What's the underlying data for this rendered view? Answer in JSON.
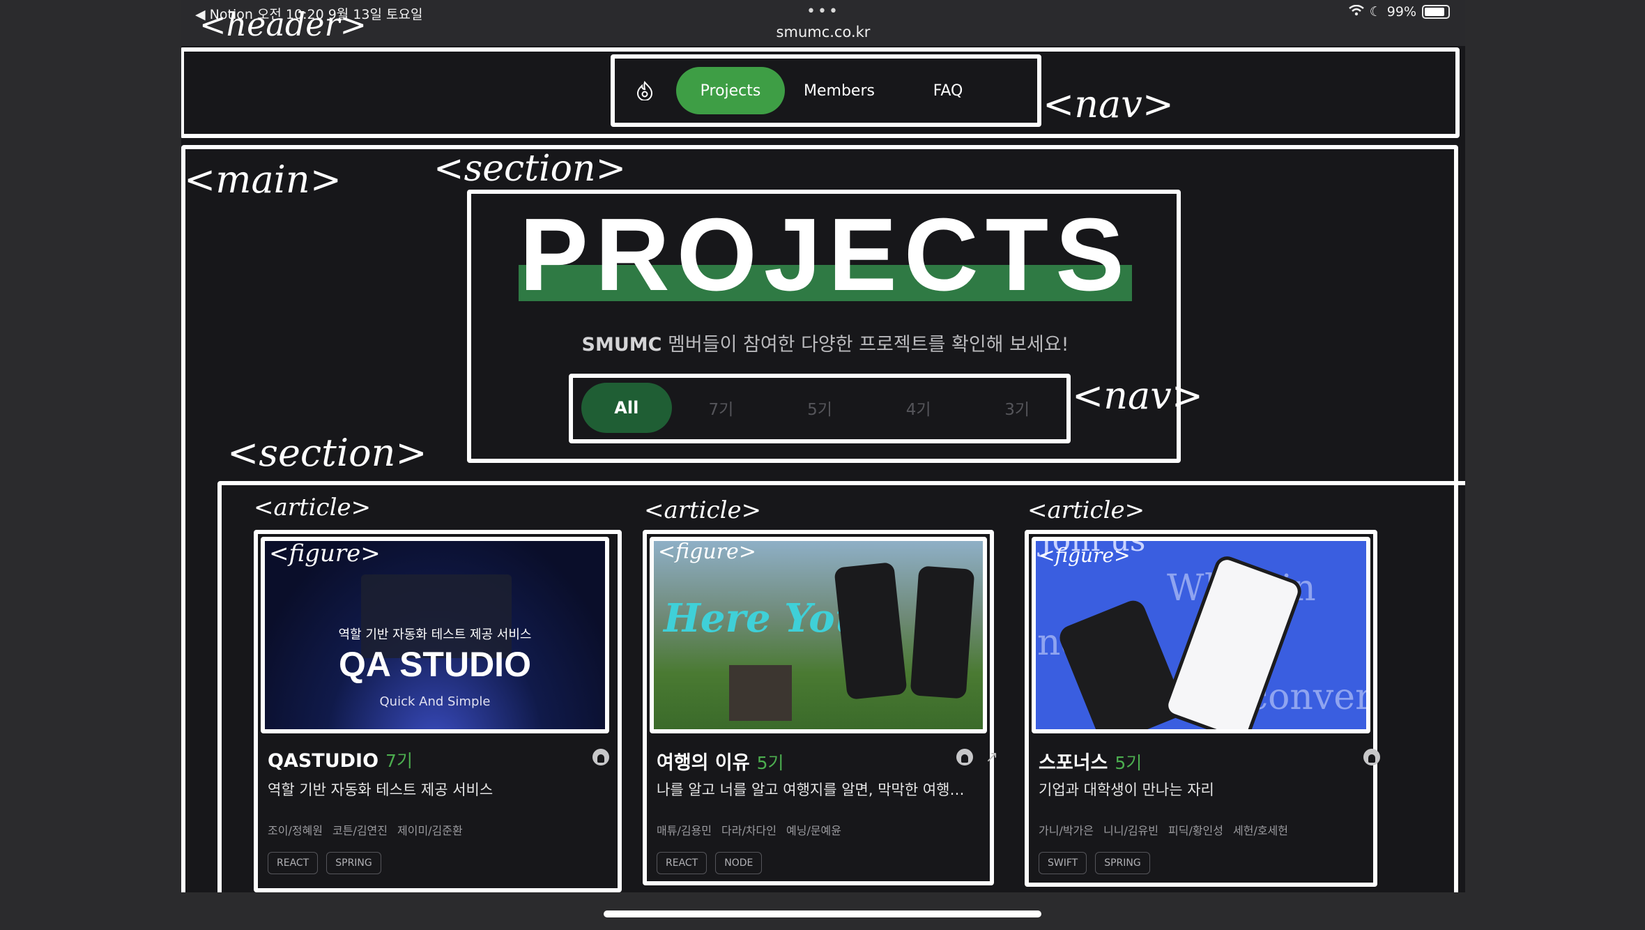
{
  "status_bar": {
    "left": "◀ Notion  오전 10:20  9월 13일 토요일",
    "battery": "99%",
    "dots": "•••",
    "url": "smumc.co.kr"
  },
  "nav": {
    "items": [
      "Projects",
      "Members",
      "FAQ"
    ],
    "active": "Projects"
  },
  "hero": {
    "title": "PROJECTS",
    "subtitle_strong": "SMUMC",
    "subtitle_rest": " 멤버들이 참여한 다양한 프로젝트를 확인해 보세요!",
    "filters": [
      "All",
      "7기",
      "5기",
      "4기",
      "3기"
    ]
  },
  "cards": [
    {
      "title": "QASTUDIO",
      "gen": "7기",
      "desc": "역할 기반 자동화 테스트 제공 서비스",
      "members": [
        "조이/정혜원",
        "코튼/김연진",
        "제이미/김준환"
      ],
      "tags": [
        "REACT",
        "SPRING"
      ],
      "image": {
        "subtitle": "역할 기반 자동화 테스트 제공 서비스",
        "logo": "QA STUDIO",
        "tagline": "Quick And Simple"
      }
    },
    {
      "title": "여행의 이유",
      "gen": "5기",
      "desc": "나를 알고 너를 알고 여행지를 알면, 막막한 여행도 ...",
      "members": [
        "매튜/김용민",
        "다라/차다인",
        "예닝/문예윤"
      ],
      "tags": [
        "REACT",
        "NODE"
      ],
      "image": {
        "logo": "Here You"
      }
    },
    {
      "title": "스포너스",
      "gen": "5기",
      "desc": "기업과 대학생이 만나는 자리",
      "members": [
        "가니/박가은",
        "니니/김유빈",
        "피딕/황인성",
        "세헌/호세헌"
      ],
      "tags": [
        "SWIFT",
        "SPRING"
      ],
      "image": {
        "text1": "Join us",
        "text2": "Wh   usin",
        "text3": "nd s",
        "text4": "converg"
      }
    }
  ],
  "annotations": {
    "header": "<header>",
    "nav1": "<nav>",
    "main": "<main>",
    "section1": "<section>",
    "nav2": "<nav>",
    "section2": "<section>",
    "article": "<article>",
    "figure": "<figure>"
  }
}
